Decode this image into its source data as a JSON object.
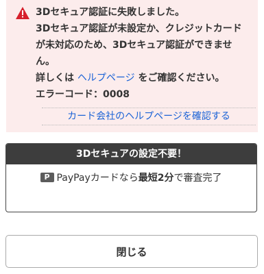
{
  "error": {
    "lines": [
      "3Dセキュア認証に失敗しました。",
      "3Dセキュア認証が未設定か、クレジットカード",
      "が未対応のため、3Dセキュア認証ができませ",
      "ん。"
    ],
    "help_prefix": "詳しくは",
    "help_link": "ヘルプページ",
    "help_suffix": "をご確認ください。",
    "code_label": "エラーコード：",
    "code_value": "0008",
    "card_help_link": "カード会社のヘルプページを確認する",
    "icon": "warning-icon",
    "icon_color": "#d6202c"
  },
  "promo": {
    "header": "3Dセキュアの設定不要！",
    "icon": "paypay-icon",
    "text_prefix": "PayPayカードなら",
    "text_bold": "最短2分",
    "text_suffix": "で審査完了"
  },
  "close_button": "閉じる",
  "colors": {
    "error_bg": "#fcecec",
    "link": "#1a62d6",
    "promo_header_bg": "#3d3d3d"
  }
}
